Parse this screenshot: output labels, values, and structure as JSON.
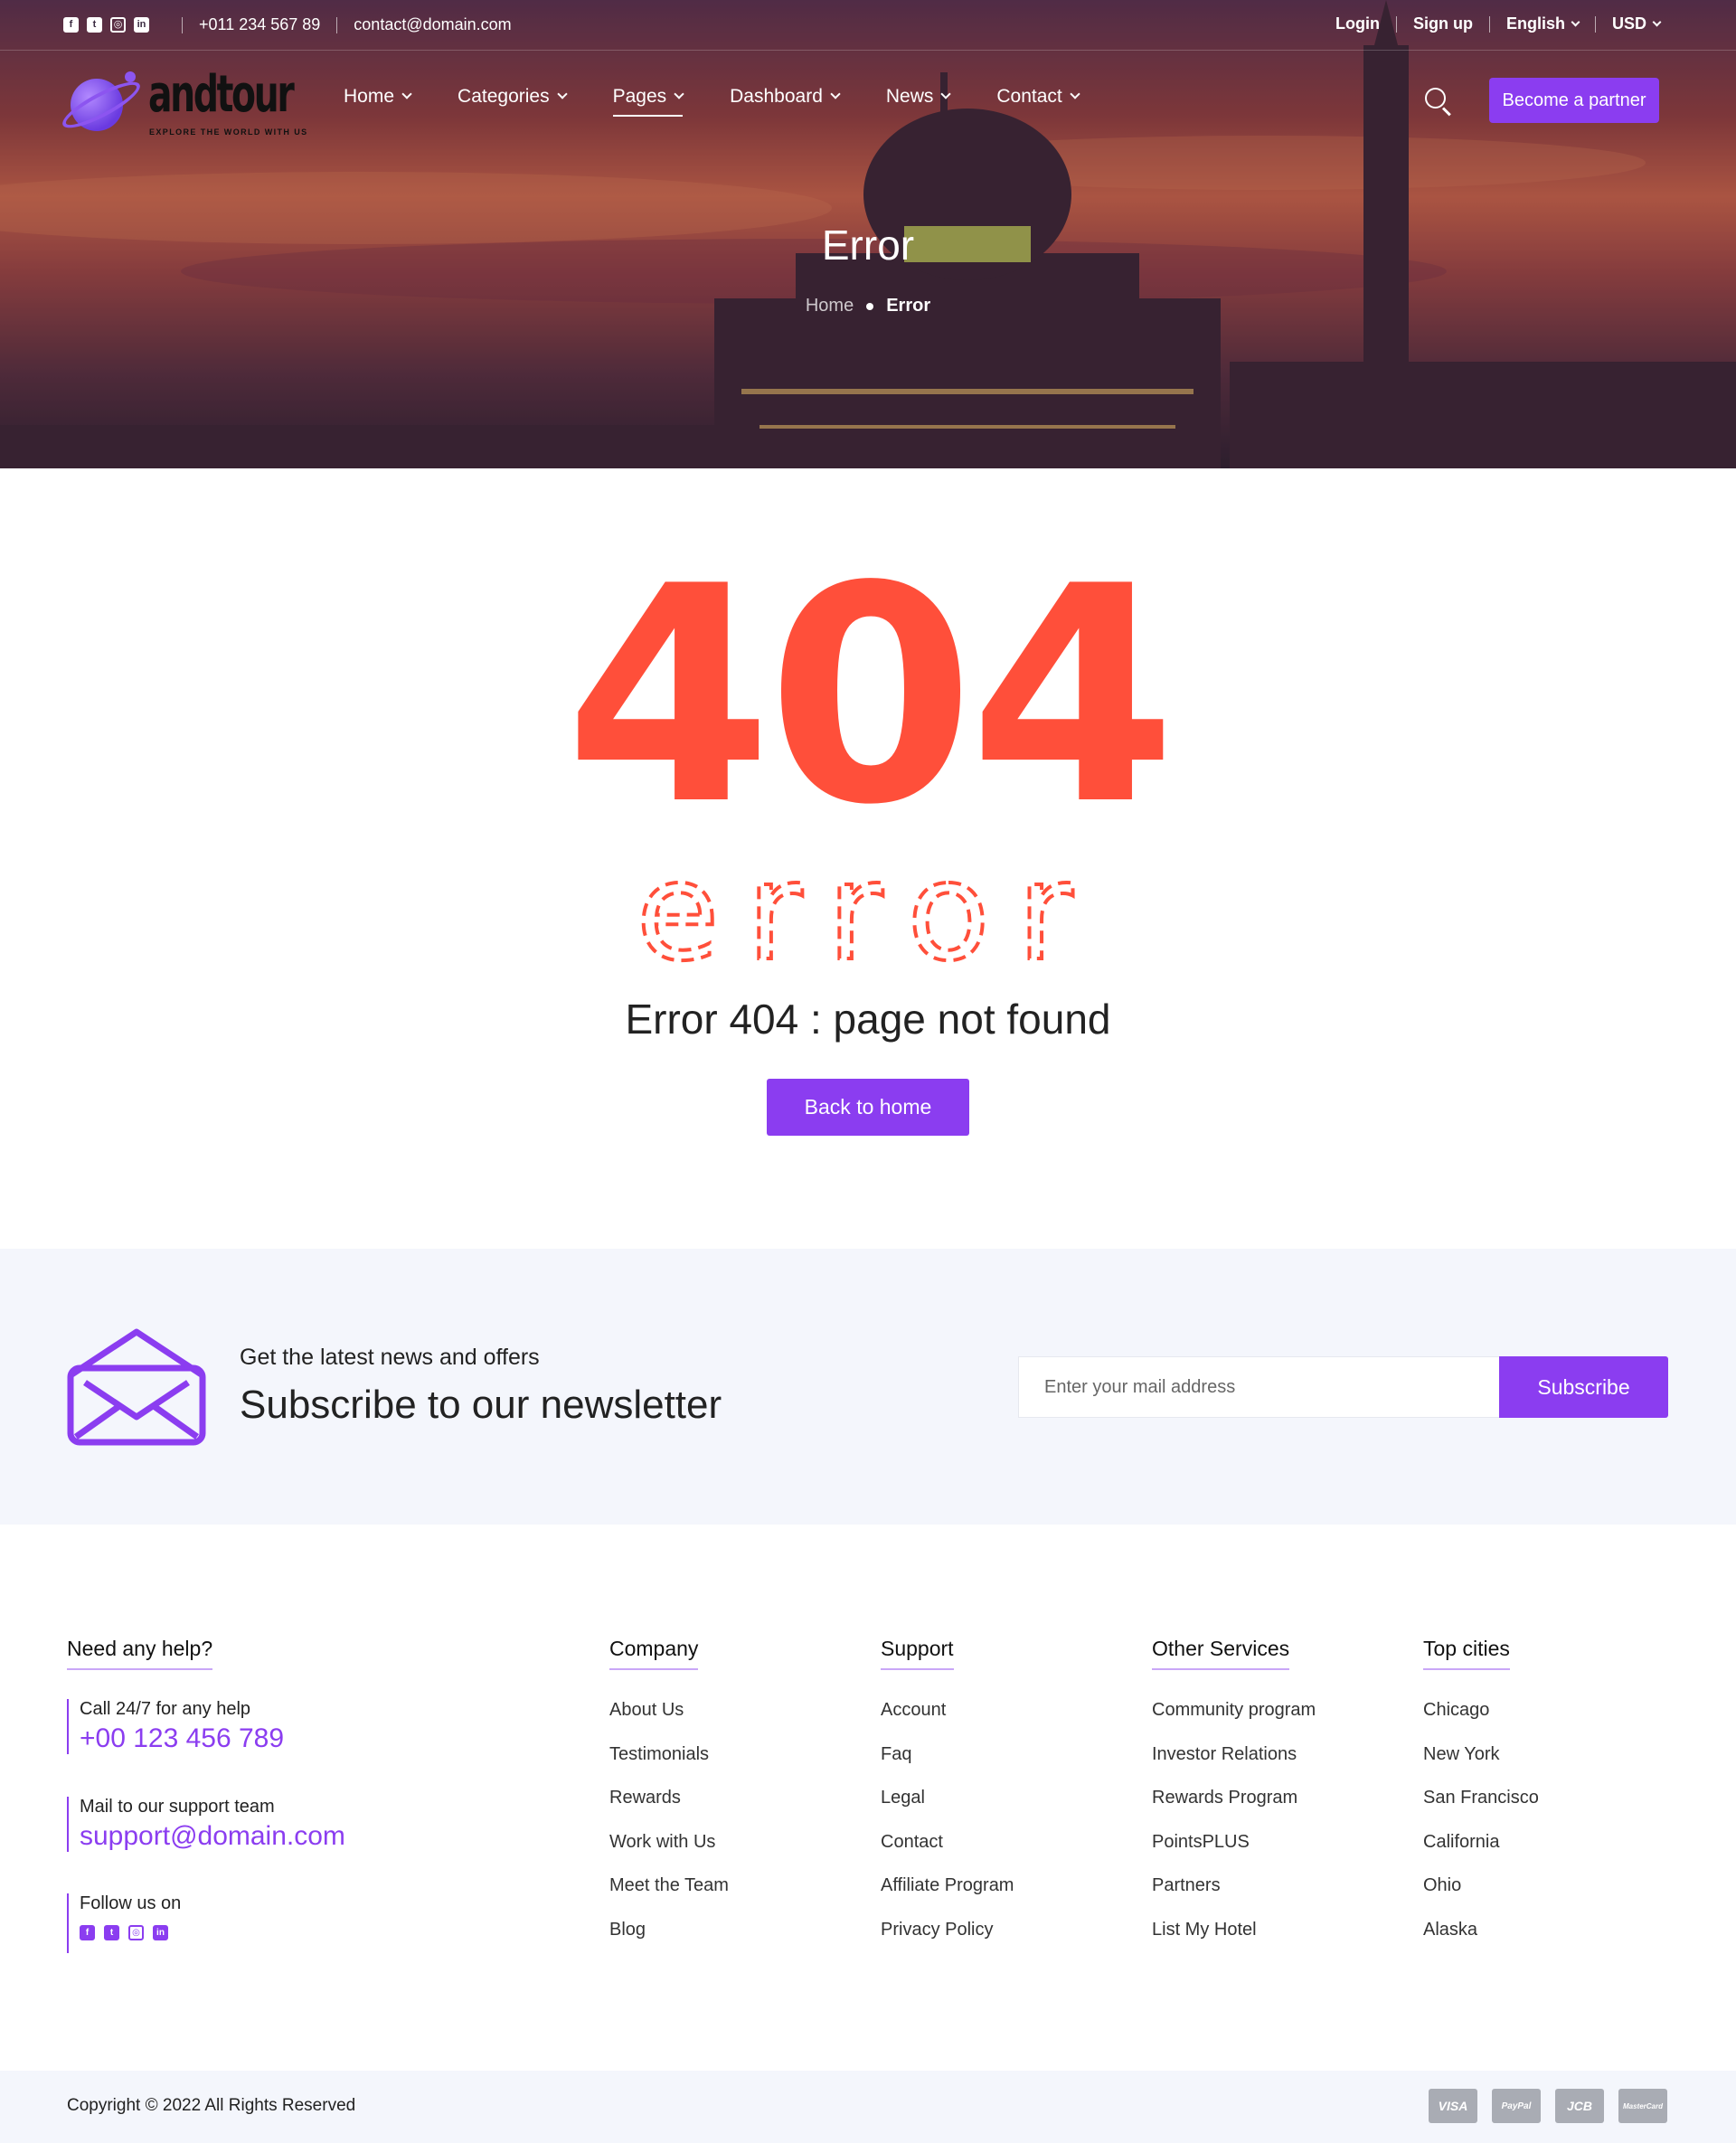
{
  "topbar": {
    "social_icons": [
      "facebook-icon",
      "twitter-icon",
      "instagram-icon",
      "linkedin-icon"
    ],
    "phone": "+011 234 567 89",
    "email": "contact@domain.com",
    "login": "Login",
    "signup": "Sign up",
    "language": "English",
    "currency": "USD"
  },
  "nav": {
    "logo_word": "andtour",
    "logo_tagline": "EXPLORE THE WORLD WITH US",
    "items": [
      "Home",
      "Categories",
      "Pages",
      "Dashboard",
      "News",
      "Contact"
    ],
    "active_item": "Pages",
    "partner_button": "Become a partner"
  },
  "hero": {
    "title": "Error",
    "breadcrumb": {
      "home": "Home",
      "current": "Error"
    }
  },
  "error": {
    "code": "404",
    "word": "error",
    "message": "Error 404 : page not found",
    "button": "Back to home"
  },
  "newsletter": {
    "subtitle": "Get the latest news and offers",
    "title": "Subscribe to our newsletter",
    "placeholder": "Enter your mail address",
    "button": "Subscribe"
  },
  "footer": {
    "help": {
      "title": "Need any help?",
      "call_label": "Call 24/7 for any help",
      "phone": "+00 123 456 789",
      "mail_label": "Mail to our support team",
      "email": "support@domain.com",
      "follow_label": "Follow us on"
    },
    "columns": [
      {
        "title": "Company",
        "links": [
          "About Us",
          "Testimonials",
          "Rewards",
          "Work with Us",
          "Meet the Team",
          "Blog"
        ]
      },
      {
        "title": "Support",
        "links": [
          "Account",
          "Faq",
          "Legal",
          "Contact",
          "Affiliate Program",
          "Privacy Policy"
        ]
      },
      {
        "title": "Other Services",
        "links": [
          "Community program",
          "Investor Relations",
          "Rewards Program",
          "PointsPLUS",
          "Partners",
          "List My Hotel"
        ]
      },
      {
        "title": "Top cities",
        "links": [
          "Chicago",
          "New York",
          "San Francisco",
          "California",
          "Ohio",
          "Alaska"
        ]
      }
    ],
    "copyright": "Copyright © 2022 All Rights Reserved",
    "payment_cards": [
      "VISA",
      "PayPal",
      "JCB",
      "MasterCard"
    ]
  },
  "colors": {
    "accent": "#8b3df0",
    "error_red": "#ff4f3a",
    "light_bg": "#f4f6fc"
  }
}
